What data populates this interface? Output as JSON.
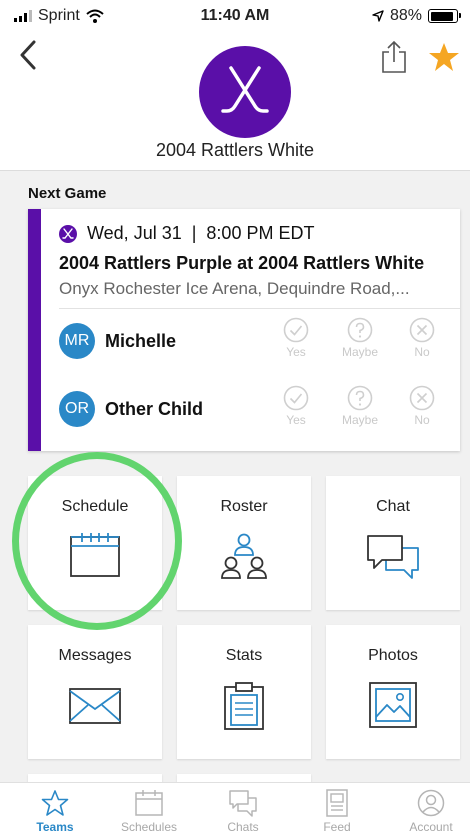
{
  "status_bar": {
    "carrier": "Sprint",
    "time": "11:40 AM",
    "battery": "88%",
    "battery_level": 0.88
  },
  "header": {
    "team_name": "2004 Rattlers White",
    "logo_icon": "hockey-sticks-icon",
    "accent_color": "#5a0fa8",
    "favorite_color": "#f5a623"
  },
  "next_game": {
    "section_label": "Next Game",
    "date": "Wed, Jul 31",
    "separator": "|",
    "time": "8:00 PM EDT",
    "matchup": "2004 Rattlers Purple at 2004 Rattlers White",
    "venue": "Onyx Rochester Ice Arena, Dequindre Road,...",
    "rsvp_options": [
      "Yes",
      "Maybe",
      "No"
    ],
    "attendees": [
      {
        "initials": "MR",
        "name": "Michelle"
      },
      {
        "initials": "OR",
        "name": "Other Child"
      }
    ]
  },
  "tiles": [
    {
      "label": "Schedule",
      "icon": "calendar-icon"
    },
    {
      "label": "Roster",
      "icon": "people-icon"
    },
    {
      "label": "Chat",
      "icon": "chat-bubbles-icon"
    },
    {
      "label": "Messages",
      "icon": "envelope-icon"
    },
    {
      "label": "Stats",
      "icon": "clipboard-icon"
    },
    {
      "label": "Photos",
      "icon": "photo-icon"
    }
  ],
  "tab_bar": {
    "items": [
      {
        "label": "Teams",
        "icon": "star-icon",
        "active": true
      },
      {
        "label": "Schedules",
        "icon": "calendar-icon",
        "active": false
      },
      {
        "label": "Chats",
        "icon": "chat-bubbles-icon",
        "active": false
      },
      {
        "label": "Feed",
        "icon": "feed-icon",
        "active": false
      },
      {
        "label": "Account",
        "icon": "account-icon",
        "active": false
      }
    ],
    "active_color": "#2a88c7"
  }
}
